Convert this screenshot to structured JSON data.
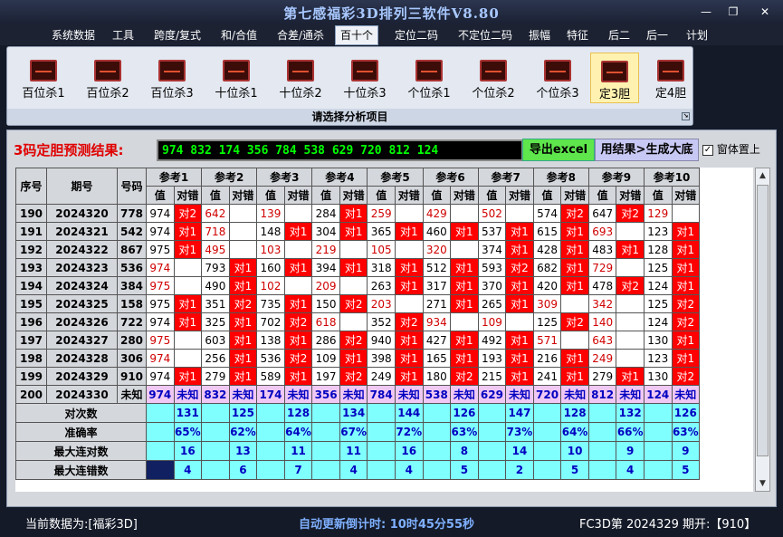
{
  "window": {
    "title": "第七感福彩3D排列三软件V8.80",
    "minimize": "—",
    "restore": "❐",
    "close": "✕"
  },
  "menu": [
    "系统数据",
    "工具",
    "跨度/复式",
    "和/合值",
    "合差/通杀",
    "百十个",
    "定位二码",
    "不定位二码",
    "振幅",
    "特征",
    "后二",
    "后一",
    "计划"
  ],
  "menu_active": "百十个",
  "toolbar": {
    "buttons": [
      "百位杀1",
      "百位杀2",
      "百位杀3",
      "十位杀1",
      "十位杀2",
      "十位杀3",
      "个位杀1",
      "个位杀2",
      "个位杀3",
      "定3胆",
      "定4胆"
    ],
    "selected": "定3胆",
    "caption": "请选择分析项目"
  },
  "result": {
    "label": "3码定胆预测结果:",
    "value": "974 832 174 356 784 538 629 720 812 124",
    "export_label": "导出excel",
    "generate_label": "用结果>生成大底",
    "pin_label": "窗体置上",
    "pin_checked": "✓"
  },
  "table": {
    "headers": {
      "seq": "序号",
      "issue": "期号",
      "num": "号码",
      "val": "值",
      "hit": "对错"
    },
    "refs": [
      "参考1",
      "参考2",
      "参考3",
      "参考4",
      "参考5",
      "参考6",
      "参考7",
      "参考8",
      "参考9",
      "参考10"
    ],
    "rows": [
      {
        "seq": "190",
        "issue": "2024320",
        "num": "778",
        "c": [
          [
            "974",
            "对2",
            1
          ],
          [
            "642",
            "",
            0
          ],
          [
            "139",
            "",
            0
          ],
          [
            "284",
            "对1",
            1
          ],
          [
            "259",
            "",
            0
          ],
          [
            "429",
            "",
            0
          ],
          [
            "502",
            "",
            0
          ],
          [
            "574",
            "对2",
            1
          ],
          [
            "647",
            "对2",
            1
          ],
          [
            "129",
            "",
            0
          ]
        ]
      },
      {
        "seq": "191",
        "issue": "2024321",
        "num": "542",
        "c": [
          [
            "974",
            "对1",
            1
          ],
          [
            "718",
            "",
            0
          ],
          [
            "148",
            "对1",
            1
          ],
          [
            "304",
            "对1",
            1
          ],
          [
            "365",
            "对1",
            1
          ],
          [
            "460",
            "对1",
            1
          ],
          [
            "537",
            "对1",
            1
          ],
          [
            "615",
            "对1",
            1
          ],
          [
            "693",
            "",
            0
          ],
          [
            "123",
            "对1",
            1
          ]
        ]
      },
      {
        "seq": "192",
        "issue": "2024322",
        "num": "867",
        "c": [
          [
            "975",
            "对1",
            1
          ],
          [
            "495",
            "",
            0
          ],
          [
            "103",
            "",
            0
          ],
          [
            "219",
            "",
            0
          ],
          [
            "105",
            "",
            0
          ],
          [
            "320",
            "",
            0
          ],
          [
            "374",
            "对1",
            1
          ],
          [
            "428",
            "对1",
            1
          ],
          [
            "483",
            "对1",
            1
          ],
          [
            "128",
            "对1",
            1
          ]
        ]
      },
      {
        "seq": "193",
        "issue": "2024323",
        "num": "536",
        "c": [
          [
            "974",
            "",
            0
          ],
          [
            "793",
            "对1",
            1
          ],
          [
            "160",
            "对1",
            1
          ],
          [
            "394",
            "对1",
            1
          ],
          [
            "318",
            "对1",
            1
          ],
          [
            "512",
            "对1",
            1
          ],
          [
            "593",
            "对2",
            1
          ],
          [
            "682",
            "对1",
            1
          ],
          [
            "729",
            "",
            0
          ],
          [
            "125",
            "对1",
            1
          ]
        ]
      },
      {
        "seq": "194",
        "issue": "2024324",
        "num": "384",
        "c": [
          [
            "975",
            "",
            0
          ],
          [
            "490",
            "对1",
            1
          ],
          [
            "102",
            "",
            0
          ],
          [
            "209",
            "",
            0
          ],
          [
            "263",
            "对1",
            1
          ],
          [
            "317",
            "对1",
            1
          ],
          [
            "370",
            "对1",
            1
          ],
          [
            "420",
            "对1",
            1
          ],
          [
            "478",
            "对2",
            1
          ],
          [
            "124",
            "对1",
            1
          ]
        ]
      },
      {
        "seq": "195",
        "issue": "2024325",
        "num": "158",
        "c": [
          [
            "975",
            "对1",
            1
          ],
          [
            "351",
            "对2",
            1
          ],
          [
            "735",
            "对1",
            1
          ],
          [
            "150",
            "对2",
            1
          ],
          [
            "203",
            "",
            0
          ],
          [
            "271",
            "对1",
            1
          ],
          [
            "265",
            "对1",
            1
          ],
          [
            "309",
            "",
            0
          ],
          [
            "342",
            "",
            0
          ],
          [
            "125",
            "对2",
            1
          ]
        ]
      },
      {
        "seq": "196",
        "issue": "2024326",
        "num": "722",
        "c": [
          [
            "974",
            "对1",
            1
          ],
          [
            "325",
            "对1",
            1
          ],
          [
            "702",
            "对2",
            1
          ],
          [
            "618",
            "",
            0
          ],
          [
            "352",
            "对2",
            1
          ],
          [
            "934",
            "",
            0
          ],
          [
            "109",
            "",
            0
          ],
          [
            "125",
            "对2",
            1
          ],
          [
            "140",
            "",
            0
          ],
          [
            "124",
            "对2",
            1
          ]
        ]
      },
      {
        "seq": "197",
        "issue": "2024327",
        "num": "280",
        "c": [
          [
            "975",
            "",
            0
          ],
          [
            "603",
            "对1",
            1
          ],
          [
            "138",
            "对1",
            1
          ],
          [
            "286",
            "对2",
            1
          ],
          [
            "940",
            "对1",
            1
          ],
          [
            "427",
            "对1",
            1
          ],
          [
            "492",
            "对1",
            1
          ],
          [
            "571",
            "",
            0
          ],
          [
            "643",
            "",
            0
          ],
          [
            "130",
            "对1",
            1
          ]
        ]
      },
      {
        "seq": "198",
        "issue": "2024328",
        "num": "306",
        "c": [
          [
            "974",
            "",
            0
          ],
          [
            "256",
            "对1",
            1
          ],
          [
            "536",
            "对2",
            1
          ],
          [
            "109",
            "对1",
            1
          ],
          [
            "398",
            "对1",
            1
          ],
          [
            "165",
            "对1",
            1
          ],
          [
            "193",
            "对1",
            1
          ],
          [
            "216",
            "对1",
            1
          ],
          [
            "249",
            "",
            0
          ],
          [
            "123",
            "对1",
            1
          ]
        ]
      },
      {
        "seq": "199",
        "issue": "2024329",
        "num": "910",
        "c": [
          [
            "974",
            "对1",
            1
          ],
          [
            "279",
            "对1",
            1
          ],
          [
            "589",
            "对1",
            1
          ],
          [
            "197",
            "对2",
            1
          ],
          [
            "249",
            "对1",
            1
          ],
          [
            "180",
            "对2",
            1
          ],
          [
            "215",
            "对1",
            1
          ],
          [
            "241",
            "对1",
            1
          ],
          [
            "279",
            "对1",
            1
          ],
          [
            "130",
            "对2",
            1
          ]
        ]
      }
    ],
    "future": {
      "seq": "200",
      "issue": "2024330",
      "num": "未知",
      "c": [
        [
          "974",
          "未知"
        ],
        [
          "832",
          "未知"
        ],
        [
          "174",
          "未知"
        ],
        [
          "356",
          "未知"
        ],
        [
          "784",
          "未知"
        ],
        [
          "538",
          "未知"
        ],
        [
          "629",
          "未知"
        ],
        [
          "720",
          "未知"
        ],
        [
          "812",
          "未知"
        ],
        [
          "124",
          "未知"
        ]
      ]
    },
    "stats": [
      {
        "label": "对次数",
        "v": [
          "131",
          "125",
          "128",
          "134",
          "144",
          "126",
          "147",
          "128",
          "132",
          "126"
        ]
      },
      {
        "label": "准确率",
        "v": [
          "65%",
          "62%",
          "64%",
          "67%",
          "72%",
          "63%",
          "73%",
          "64%",
          "66%",
          "63%"
        ]
      },
      {
        "label": "最大连对数",
        "v": [
          "16",
          "13",
          "11",
          "11",
          "16",
          "8",
          "14",
          "10",
          "9",
          "9"
        ]
      },
      {
        "label": "最大连错数",
        "v": [
          "4",
          "6",
          "7",
          "4",
          "4",
          "5",
          "2",
          "5",
          "4",
          "5"
        ]
      }
    ]
  },
  "status": {
    "data_label": "当前数据为:[福彩3D]",
    "countdown": "自动更新倒计时:  10时45分55秒",
    "draw": "FC3D第 2024329 期开:【910】"
  }
}
